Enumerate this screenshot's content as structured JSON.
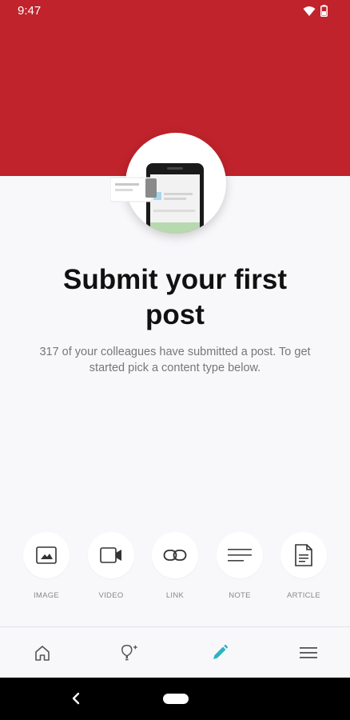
{
  "status": {
    "time": "9:47"
  },
  "empty_state": {
    "title": "Submit your first post",
    "description": "317 of your colleagues have submitted a post. To get started pick a content type below."
  },
  "content_types": [
    {
      "label": "IMAGE",
      "icon": "image-icon"
    },
    {
      "label": "VIDEO",
      "icon": "video-icon"
    },
    {
      "label": "LINK",
      "icon": "link-icon"
    },
    {
      "label": "NOTE",
      "icon": "note-icon"
    },
    {
      "label": "ARTICLE",
      "icon": "article-icon"
    }
  ],
  "bottom_nav": [
    {
      "icon": "home-icon",
      "active": false
    },
    {
      "icon": "lightbulb-icon",
      "active": false
    },
    {
      "icon": "pencil-icon",
      "active": true
    },
    {
      "icon": "menu-icon",
      "active": false
    }
  ],
  "colors": {
    "brand_red": "#c0232c",
    "active_tab": "#2bb3c0",
    "background": "#f8f8fb"
  }
}
